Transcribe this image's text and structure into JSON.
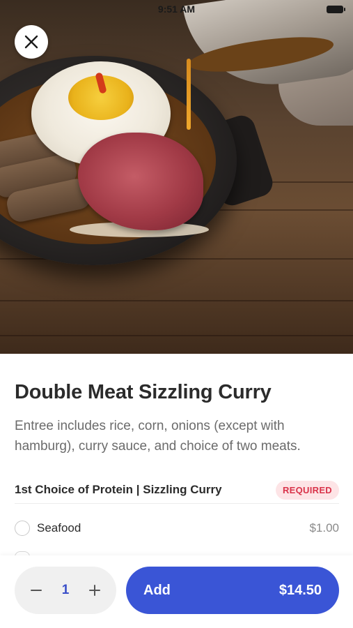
{
  "status_bar": {
    "time": "9:51 AM"
  },
  "hero": {
    "image_alt": "sizzling-curry-photo"
  },
  "close_button": {
    "icon": "close-icon"
  },
  "item": {
    "title": "Double Meat Sizzling Curry",
    "description": "Entree includes rice, corn, onions (except with hamburg), curry sauce, and choice of two meats."
  },
  "section": {
    "title": "1st Choice of Protein | Sizzling Curry",
    "badge": "REQUIRED",
    "options": [
      {
        "label": "Seafood",
        "price": "$1.00",
        "selected": false
      }
    ]
  },
  "bottom_bar": {
    "quantity": "1",
    "minus_icon": "minus-icon",
    "plus_icon": "plus-icon",
    "add_label": "Add",
    "add_price": "$14.50"
  },
  "colors": {
    "accent": "#3a55d6",
    "badge_bg": "#fde4e6",
    "badge_text": "#d9334a",
    "quantity_text": "#3a4fc9"
  }
}
